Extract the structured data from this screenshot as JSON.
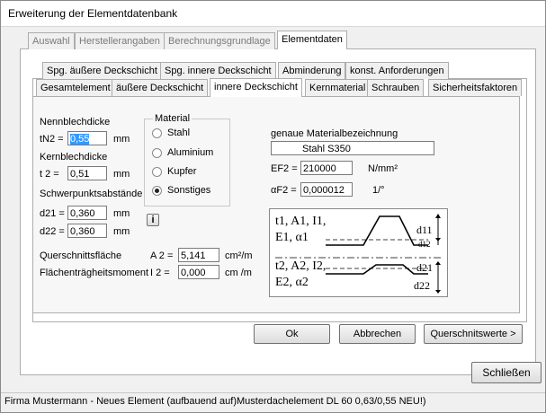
{
  "window": {
    "title": "Erweiterung der Elementdatenbank"
  },
  "tabs_row1": [
    {
      "label": "Auswahl",
      "disabled": true
    },
    {
      "label": "Herstellerangaben",
      "disabled": true
    },
    {
      "label": "Berechnungsgrundlage",
      "disabled": true
    },
    {
      "label": "Elementdaten",
      "active": true
    }
  ],
  "tabs_row2": [
    {
      "label": "Spg. äußere Deckschicht"
    },
    {
      "label": "Spg. innere Deckschicht"
    },
    {
      "label": "Abminderung"
    },
    {
      "label": "konst. Anforderungen"
    }
  ],
  "tabs_row3": [
    {
      "label": "Gesamtelement"
    },
    {
      "label": "äußere Deckschicht"
    },
    {
      "label": "innere Deckschicht",
      "active": true
    },
    {
      "label": "Kernmaterial"
    },
    {
      "label": "Schrauben"
    },
    {
      "label": "Sicherheitsfaktoren"
    }
  ],
  "form": {
    "nennblechdicke_label": "Nennblechdicke",
    "tn2_label": "tN2 =",
    "tn2_value": "0,55",
    "tn2_unit": "mm",
    "kernblechdicke_label": "Kernblechdicke",
    "t2_label": "t 2 =",
    "t2_value": "0,51",
    "t2_unit": "mm",
    "schwerpunkt_label": "Schwerpunktsabstände",
    "d21_label": "d21 =",
    "d21_value": "0,360",
    "d21_unit": "mm",
    "d22_label": "d22 =",
    "d22_value": "0,360",
    "d22_unit": "mm",
    "info_button": "i",
    "querschnitt_label": "Querschnittsfläche",
    "a2_label": "A 2 =",
    "a2_value": "5,141",
    "a2_unit": "cm²/m",
    "flaechen_label": "Flächenträgheitsmoment",
    "i2_label": "I 2 =",
    "i2_value": "0,000",
    "i2_unit": "cm  /m"
  },
  "material": {
    "group_label": "Material",
    "options": [
      {
        "label": "Stahl",
        "selected": false
      },
      {
        "label": "Aluminium",
        "selected": false
      },
      {
        "label": "Kupfer",
        "selected": false
      },
      {
        "label": "Sonstiges",
        "selected": true
      }
    ],
    "bezeichnung_label": "genaue Materialbezeichnung",
    "bezeichnung_value": "Stahl S350",
    "ef2_label": "EF2 =",
    "ef2_value": "210000",
    "ef2_unit": "N/mm²",
    "alpha_label": "αF2 =",
    "alpha_value": "0,000012",
    "alpha_unit": "1/°"
  },
  "diagram": {
    "top_symbols": "t1, A1, I1,",
    "top_symbols2": "E1, α1",
    "top_d11": "d11",
    "top_d12": "d12",
    "bot_symbols": "t2, A2, I2,",
    "bot_symbols2": "E2, α2",
    "bot_d21": "d21",
    "bot_d22": "d22"
  },
  "buttons": {
    "ok": "Ok",
    "abbrechen": "Abbrechen",
    "querschnittswerte": "Querschnitswerte >",
    "schliessen": "Schließen"
  },
  "status": {
    "text": "Firma Mustermann - Neues Element  (aufbauend auf)Musterdachelement DL 60 0,63/0,55 NEU!)"
  }
}
